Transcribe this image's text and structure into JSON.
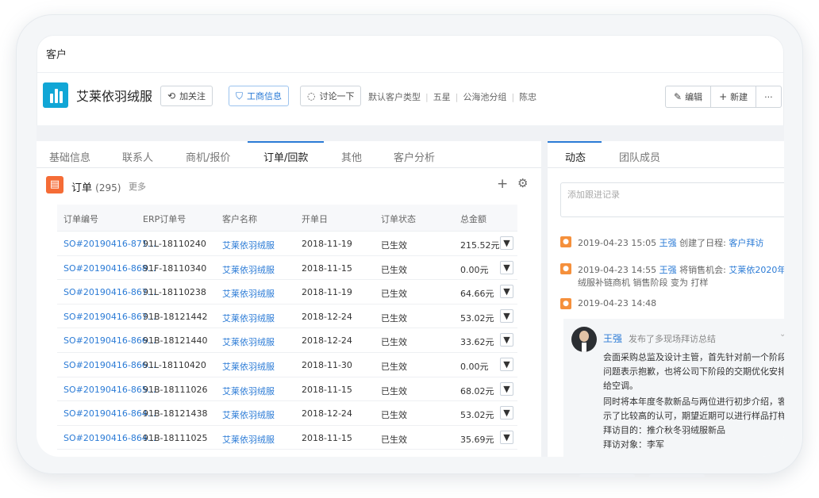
{
  "window": {
    "title": "客户"
  },
  "header": {
    "company_name": "艾莱依羽绒服",
    "follow_label": "加关注",
    "business_info_label": "工商信息",
    "discuss_label": "讨论一下",
    "meta": [
      "默认客户类型",
      "五星",
      "公海池分组",
      "陈忠"
    ],
    "edit_label": "编辑",
    "new_label": "新建",
    "more_label": "···"
  },
  "left_tabs": [
    "基础信息",
    "联系人",
    "商机/报价",
    "订单/回款",
    "其他",
    "客户分析"
  ],
  "orders": {
    "title": "订单",
    "count": "(295)",
    "more_label": "更多",
    "columns": [
      "订单编号",
      "ERP订单号",
      "客户名称",
      "开单日",
      "订单状态",
      "总金额"
    ],
    "rows": [
      [
        "SO#20190416-871...",
        "91L-18110240",
        "艾莱依羽绒服",
        "2018-11-19",
        "已生效",
        "215.52元"
      ],
      [
        "SO#20190416-868...",
        "91F-18110340",
        "艾莱依羽绒服",
        "2018-11-15",
        "已生效",
        "0.00元"
      ],
      [
        "SO#20190416-867...",
        "91L-18110238",
        "艾莱依羽绒服",
        "2018-11-19",
        "已生效",
        "64.66元"
      ],
      [
        "SO#20190416-867...",
        "91B-18121442",
        "艾莱依羽绒服",
        "2018-12-24",
        "已生效",
        "53.02元"
      ],
      [
        "SO#20190416-866...",
        "91B-18121440",
        "艾莱依羽绒服",
        "2018-12-24",
        "已生效",
        "33.62元"
      ],
      [
        "SO#20190416-866...",
        "91L-18110420",
        "艾莱依羽绒服",
        "2018-11-30",
        "已生效",
        "0.00元"
      ],
      [
        "SO#20190416-865...",
        "91B-18111026",
        "艾莱依羽绒服",
        "2018-11-15",
        "已生效",
        "68.02元"
      ],
      [
        "SO#20190416-864...",
        "91B-18121438",
        "艾莱依羽绒服",
        "2018-12-24",
        "已生效",
        "53.02元"
      ],
      [
        "SO#20190416-864...",
        "91B-18111025",
        "艾莱依羽绒服",
        "2018-11-15",
        "已生效",
        "35.69元"
      ]
    ]
  },
  "right_tabs": [
    "动态",
    "团队成员"
  ],
  "activity": {
    "input_placeholder": "添加跟进记录",
    "items": [
      {
        "time": "2019-04-23 15:05",
        "user": "王强",
        "action": "创建了日程:",
        "target": "客户拜访",
        "line2": ""
      },
      {
        "time": "2019-04-23 14:55",
        "user": "王强",
        "action": "将销售机会:",
        "target": "艾莱依2020年秋冬羽",
        "line2": "绒服补链商机 销售阶段 变为 打样"
      },
      {
        "time": "2019-04-23 14:48",
        "user": "",
        "action": "",
        "target": "",
        "line2": ""
      }
    ],
    "card": {
      "user": "王强",
      "action": "发布了多现场拜访总结",
      "lines": [
        "会面采购总监及设计主管，首先针对前一个阶段交期",
        "问题表示抱歉，也将公司下阶段的交期优化安排传达",
        "给空调。",
        "同时将本年度冬款新品与两位进行初步介绍，客户表",
        "示了比较高的认可，期望近期可以进行样品打样。",
        "拜访目的：推介秋冬羽绒服新品",
        "拜访对象：李军"
      ]
    }
  },
  "icons": [
    "building-icon",
    "follow-icon",
    "shield-icon",
    "chat-icon",
    "pencil-icon",
    "plus-icon",
    "gear-icon",
    "document-icon",
    "location-pin-icon",
    "chevron-down-icon"
  ],
  "colors": {
    "accent": "#2b7bd6",
    "logo": "#11a6d6",
    "order_icon": "#f56c36",
    "pin": "#f5903c"
  }
}
